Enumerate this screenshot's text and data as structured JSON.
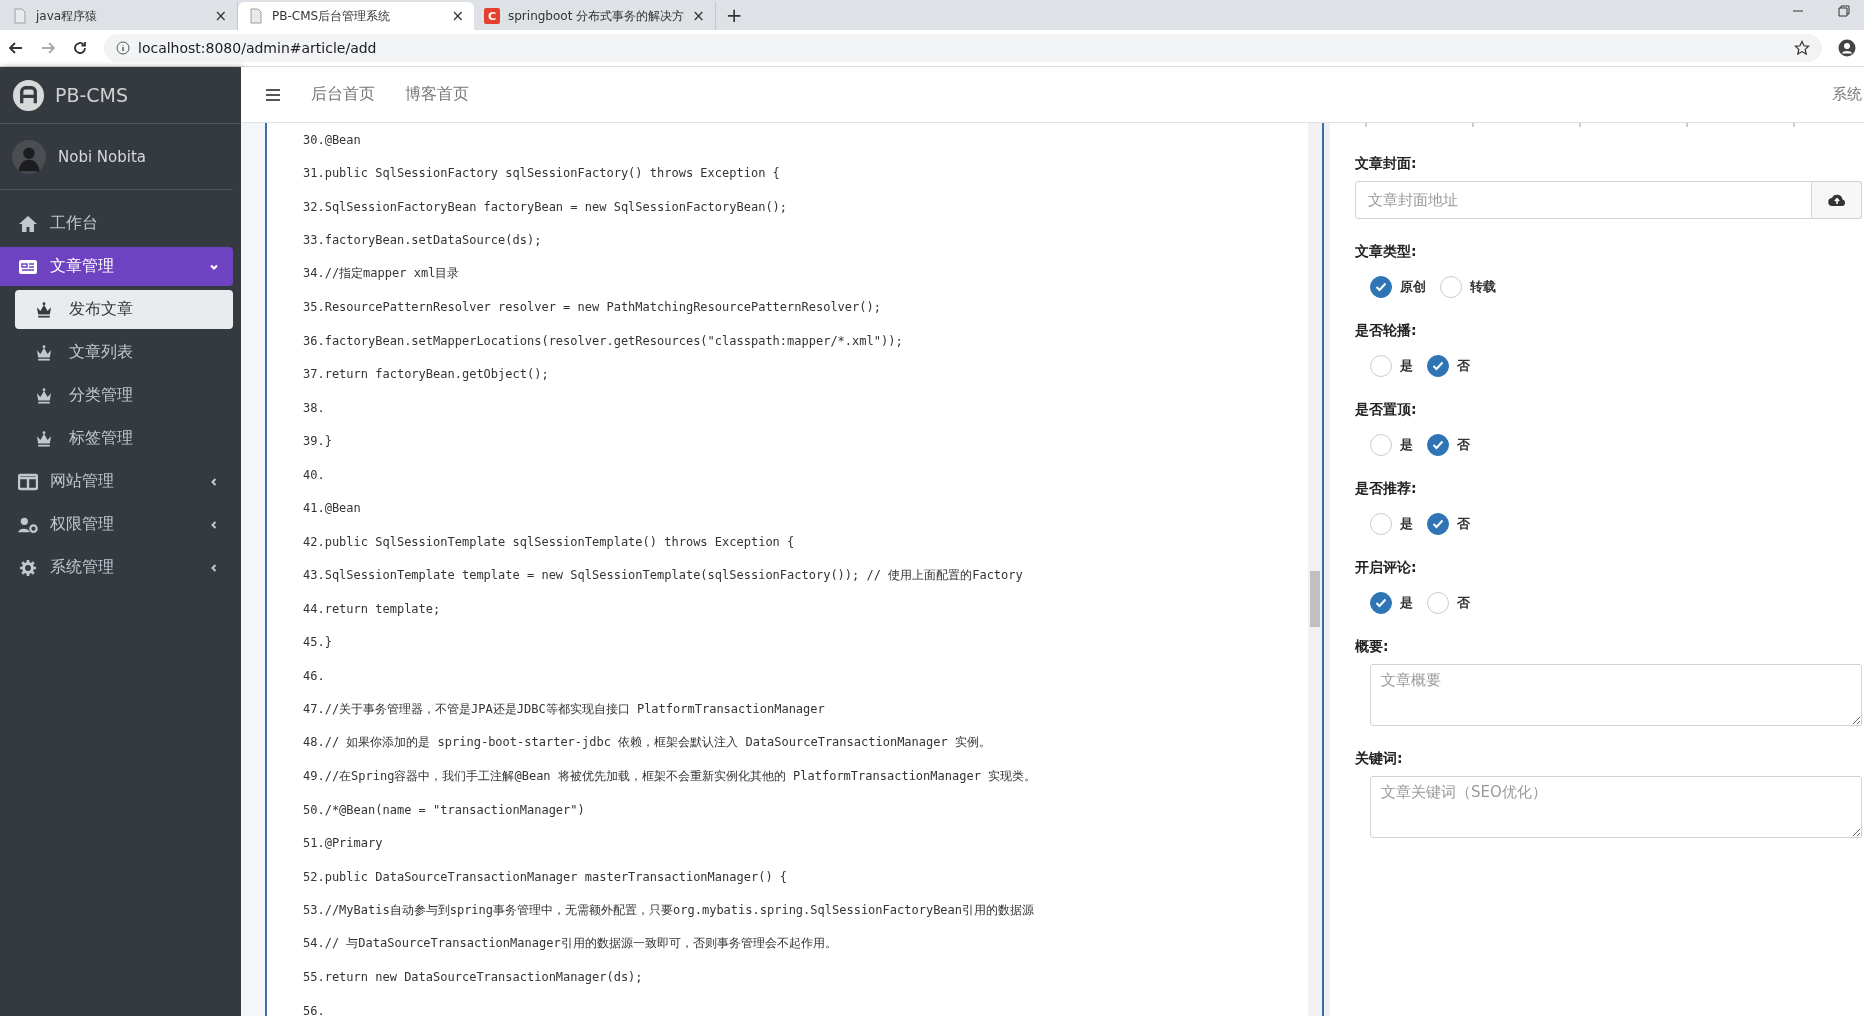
{
  "browser": {
    "tabs": [
      {
        "title": "java程序猿",
        "selected": false
      },
      {
        "title": "PB-CMS后台管理系统",
        "selected": true
      },
      {
        "title": "springboot 分布式事务的解决方",
        "selected": false,
        "favicon_letter": "C"
      }
    ],
    "new_tab": "+",
    "close": "×",
    "url": "localhost:8080/admin#article/add"
  },
  "sidebar": {
    "brand": "PB-CMS",
    "user": "Nobi Nobita",
    "items": [
      {
        "label": "工作台",
        "selected": false
      },
      {
        "label": "文章管理",
        "selected": true,
        "expanded": true,
        "children": [
          {
            "label": "发布文章",
            "selected": true
          },
          {
            "label": "文章列表",
            "selected": false
          },
          {
            "label": "分类管理",
            "selected": false
          },
          {
            "label": "标签管理",
            "selected": false
          }
        ]
      },
      {
        "label": "网站管理",
        "selected": false,
        "expanded": false
      },
      {
        "label": "权限管理",
        "selected": false,
        "expanded": false
      },
      {
        "label": "系统管理",
        "selected": false,
        "expanded": false
      }
    ]
  },
  "header": {
    "links": [
      "后台首页",
      "博客首页"
    ],
    "right_menu": "系统"
  },
  "editor": {
    "lines": [
      "30.@Bean",
      "31.public SqlSessionFactory sqlSessionFactory() throws Exception {",
      "32.SqlSessionFactoryBean factoryBean = new SqlSessionFactoryBean();",
      "33.factoryBean.setDataSource(ds);",
      "34.//指定mapper xml目录",
      "35.ResourcePatternResolver resolver = new PathMatchingResourcePatternResolver();",
      "36.factoryBean.setMapperLocations(resolver.getResources(\"classpath:mapper/*.xml\"));",
      "37.return factoryBean.getObject();",
      "38.",
      "39.}",
      "40.",
      "41.@Bean",
      "42.public SqlSessionTemplate sqlSessionTemplate() throws Exception {",
      "43.SqlSessionTemplate template = new SqlSessionTemplate(sqlSessionFactory()); // 使用上面配置的Factory",
      "44.return template;",
      "45.}",
      "46.",
      "47.//关于事务管理器，不管是JPA还是JDBC等都实现自接口 PlatformTransactionManager",
      "48.// 如果你添加的是 spring-boot-starter-jdbc 依赖，框架会默认注入 DataSourceTransactionManager 实例。",
      "49.//在Spring容器中，我们手工注解@Bean 将被优先加载，框架不会重新实例化其他的 PlatformTransactionManager 实现类。",
      "50./*@Bean(name = \"transactionManager\")",
      "51.@Primary",
      "52.public DataSourceTransactionManager masterTransactionManager() {",
      "53.//MyBatis自动参与到spring事务管理中，无需额外配置，只要org.mybatis.spring.SqlSessionFactoryBean引用的数据源",
      "54.// 与DataSourceTransactionManager引用的数据源一致即可，否则事务管理会不起作用。",
      "55.return new DataSourceTransactionManager(ds);",
      "56."
    ]
  },
  "form": {
    "cover": {
      "label": "文章封面:",
      "placeholder": "文章封面地址"
    },
    "radio_groups": [
      {
        "label": "文章类型:",
        "options": [
          {
            "label": "原创",
            "selected": true
          },
          {
            "label": "转载",
            "selected": false
          }
        ]
      },
      {
        "label": "是否轮播:",
        "options": [
          {
            "label": "是",
            "selected": false
          },
          {
            "label": "否",
            "selected": true
          }
        ]
      },
      {
        "label": "是否置顶:",
        "options": [
          {
            "label": "是",
            "selected": false
          },
          {
            "label": "否",
            "selected": true
          }
        ]
      },
      {
        "label": "是否推荐:",
        "options": [
          {
            "label": "是",
            "selected": false
          },
          {
            "label": "否",
            "selected": true
          }
        ]
      },
      {
        "label": "开启评论:",
        "options": [
          {
            "label": "是",
            "selected": true
          },
          {
            "label": "否",
            "selected": false
          }
        ]
      }
    ],
    "summary": {
      "label": "概要:",
      "placeholder": "文章概要"
    },
    "keywords": {
      "label": "关键词:",
      "placeholder": "文章关键词（SEO优化）"
    }
  }
}
